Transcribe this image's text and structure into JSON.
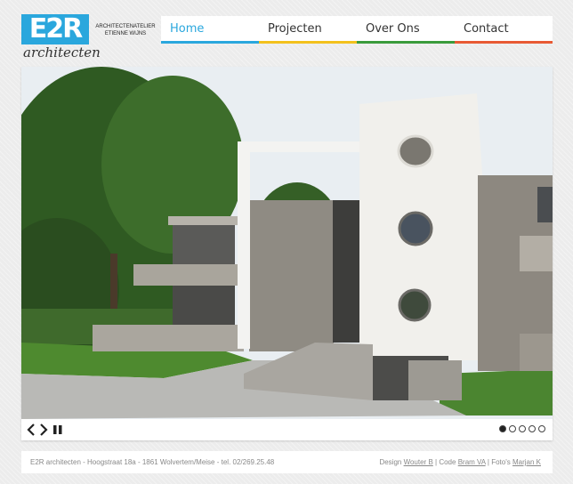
{
  "logo": {
    "mark": "E2R",
    "tagline_1": "ARCHITECTENATELIER",
    "tagline_2": "ETIENNE WIJNS",
    "word": "architecten"
  },
  "nav": {
    "items": [
      {
        "label": "Home",
        "color": "#2aa7dd",
        "active": true
      },
      {
        "label": "Projecten",
        "color": "#f3c11d",
        "active": false
      },
      {
        "label": "Over Ons",
        "color": "#3a9b3c",
        "active": false
      },
      {
        "label": "Contact",
        "color": "#e85a34",
        "active": false
      }
    ]
  },
  "slider": {
    "icons": {
      "prev": "chevron-left-icon",
      "next": "chevron-right-icon",
      "pause": "pause-icon"
    },
    "dots_count": 5,
    "active_dot": 1
  },
  "footer": {
    "left": "E2R architecten - Hoogstraat 18a - 1861 Wolvertem/Meise - tel. 02/269.25.48",
    "design_prefix": "Design",
    "design_name": "Wouter B",
    "code_prefix": "| Code",
    "code_name": "Bram VA",
    "photo_prefix": "| Foto's",
    "photo_name": "Marjan K"
  }
}
